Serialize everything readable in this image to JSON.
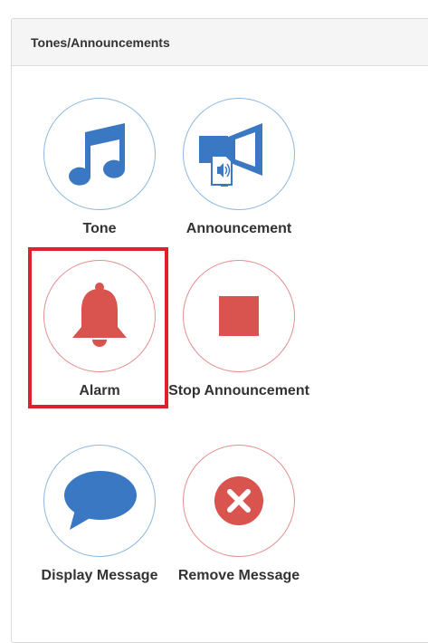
{
  "panel": {
    "title": "Tones/Announcements"
  },
  "tiles": [
    {
      "label": "Tone",
      "icon": "music-note-icon",
      "color": "#3a78c3"
    },
    {
      "label": "Announcement",
      "icon": "megaphone-icon",
      "color": "#3a78c3"
    },
    {
      "label": "Alarm",
      "icon": "bell-icon",
      "color": "#d9534f",
      "highlighted": true
    },
    {
      "label": "Stop Announcement",
      "icon": "stop-square-icon",
      "color": "#d9534f"
    },
    {
      "label": "Display Message",
      "icon": "speech-bubble-icon",
      "color": "#3a78c3"
    },
    {
      "label": "Remove Message",
      "icon": "x-circle-icon",
      "color": "#d9534f"
    }
  ],
  "colors": {
    "blue": "#3a78c3",
    "red": "#d9534f",
    "highlight": "#e0202a"
  }
}
